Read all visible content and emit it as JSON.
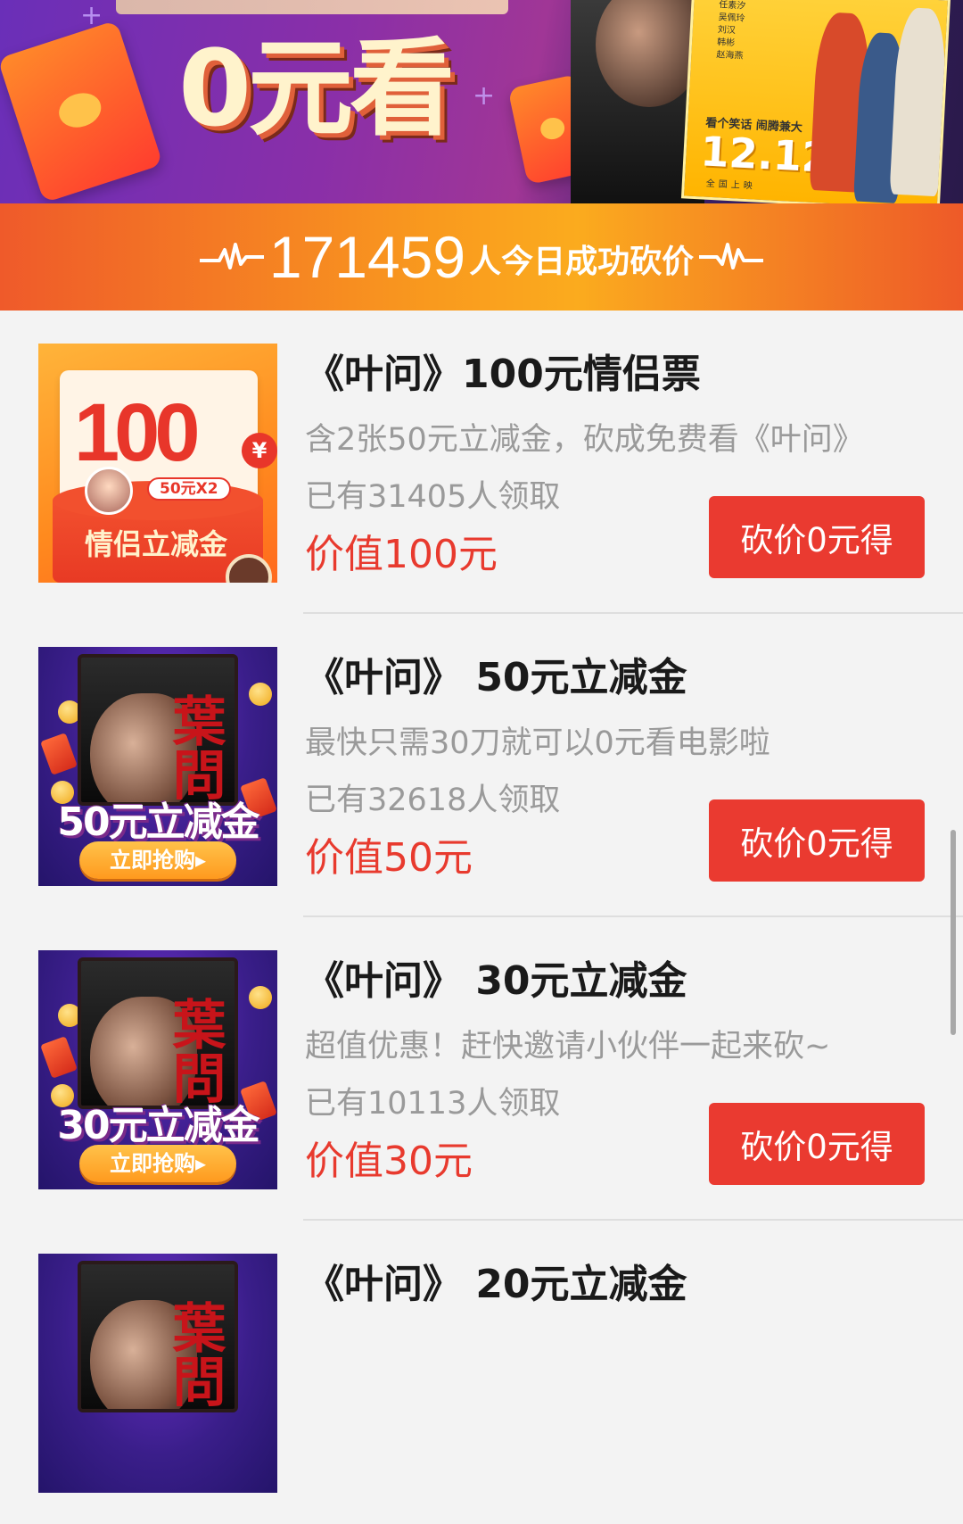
{
  "banner": {
    "headline": "0元看",
    "poster_names": [
      "任素汐",
      "吴佩玲",
      "刘汉",
      "韩彬",
      "赵海燕"
    ],
    "poster_tagline": "看个笑话 闹腾兼大",
    "poster_date": "12.12",
    "poster_release": "全国上映"
  },
  "counter": {
    "count": "171459",
    "label": "人今日成功砍价"
  },
  "items": [
    {
      "title": "《叶问》100元情侣票",
      "desc": "含2张50元立减金，砍成免费看《叶问》",
      "claimed": "已有31405人领取",
      "value": "价值100元",
      "button": "砍价0元得",
      "thumb": {
        "amount": "100",
        "currency": "¥",
        "pill": "50元X2",
        "label": "情侣立减金"
      }
    },
    {
      "title": "《叶问》 50元立减金",
      "desc": "最快只需30刀就可以0元看电影啦",
      "claimed": "已有32618人领取",
      "value": "价值50元",
      "button": "砍价0元得",
      "thumb": {
        "calligraphy": "葉問",
        "label": "50元立减金",
        "grab": "立即抢购▸"
      }
    },
    {
      "title": "《叶问》 30元立减金",
      "desc": "超值优惠！赶快邀请小伙伴一起来砍~",
      "claimed": "已有10113人领取",
      "value": "价值30元",
      "button": "砍价0元得",
      "thumb": {
        "calligraphy": "葉問",
        "label": "30元立减金",
        "grab": "立即抢购▸"
      }
    },
    {
      "title": "《叶问》 20元立减金",
      "thumb": {
        "calligraphy": "葉問"
      }
    }
  ],
  "colors": {
    "accent_red": "#ea3a30",
    "price_red": "#e83a2e",
    "strip_orange": "#f99a1e",
    "muted_text": "#9a9a9a"
  }
}
